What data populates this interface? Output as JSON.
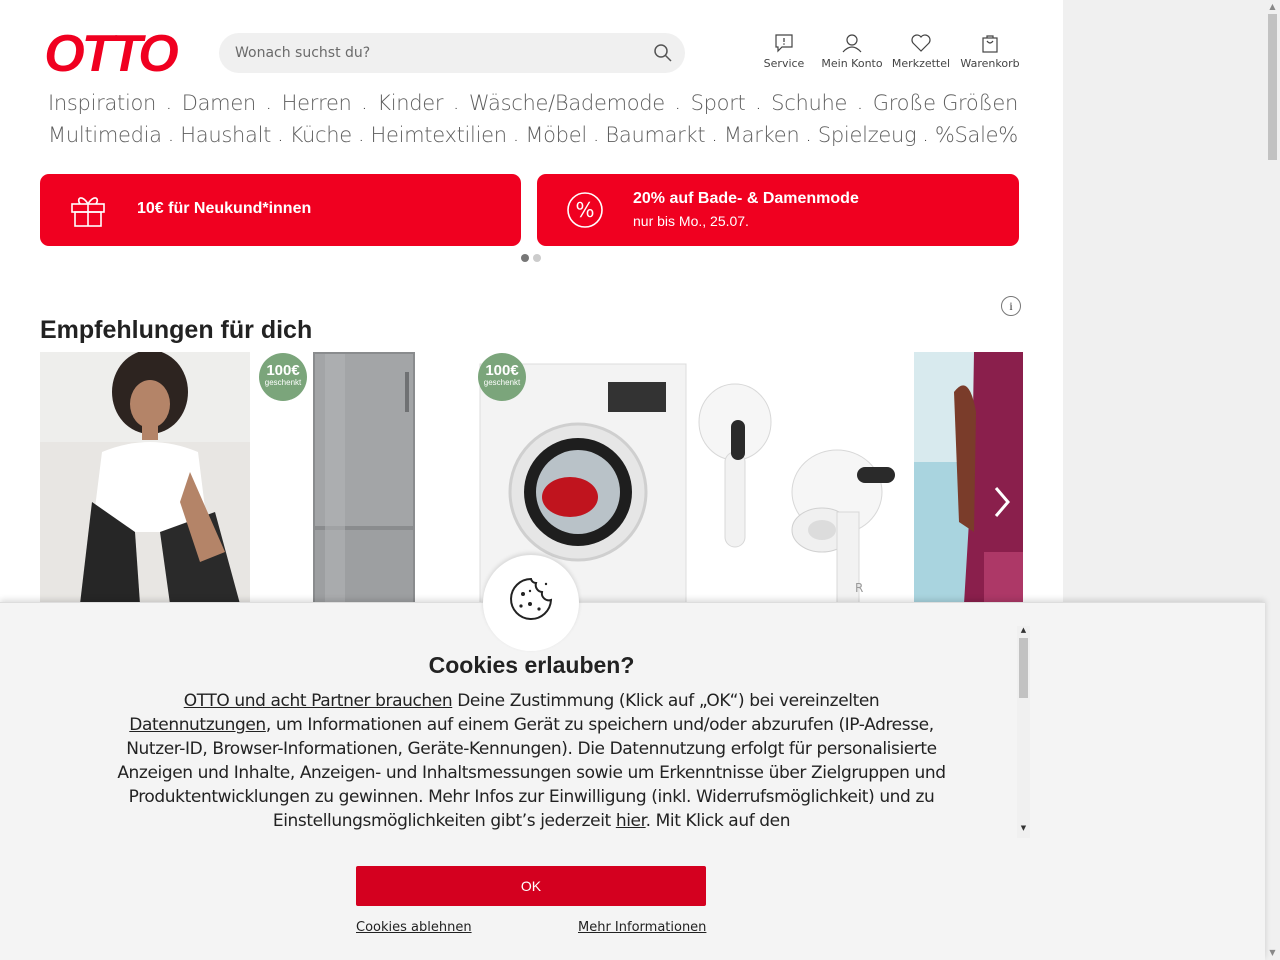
{
  "brand": {
    "logo_text": "OTTO",
    "color": "#f00020"
  },
  "search": {
    "placeholder": "Wonach suchst du?",
    "icon": "search-icon"
  },
  "header_actions": [
    {
      "label": "Service",
      "icon": "chat-icon"
    },
    {
      "label": "Mein Konto",
      "icon": "user-icon"
    },
    {
      "label": "Merkzettel",
      "icon": "heart-icon"
    },
    {
      "label": "Warenkorb",
      "icon": "bag-icon"
    }
  ],
  "nav": {
    "row1": [
      "Inspiration",
      "Damen",
      "Herren",
      "Kinder",
      "Wäsche/Bademode",
      "Sport",
      "Schuhe",
      "Große Größen"
    ],
    "row2": [
      "Multimedia",
      "Haushalt",
      "Küche",
      "Heimtextilien",
      "Möbel",
      "Baumarkt",
      "Marken",
      "Spielzeug",
      "%Sale%"
    ]
  },
  "promos": [
    {
      "title": "10€ für Neukund*innen",
      "subtitle": "",
      "icon": "gift-icon"
    },
    {
      "title": "20% auf Bade- & Damenmode",
      "subtitle": "nur bis Mo., 25.07.",
      "icon": "percent-icon"
    }
  ],
  "carousel": {
    "dots": 2,
    "active": 0
  },
  "recommendations": {
    "title": "Empfehlungen für dich",
    "info_label": "i",
    "badge": {
      "amount": "100€",
      "text": "geschenkt"
    },
    "products": [
      {
        "name": "woman-white-tshirt-image"
      },
      {
        "name": "fridge-image"
      },
      {
        "name": "washing-machine-image"
      },
      {
        "name": "earbuds-image"
      },
      {
        "name": "beach-dress-image"
      }
    ]
  },
  "cookie": {
    "title": "Cookies erlauben?",
    "link_partners": "OTTO und acht Partner brauchen",
    "text1": " Deine Zustimmung (Klick auf „OK“) bei vereinzelten ",
    "link_data": "Datennutzungen",
    "text2": ", um Informationen auf einem Gerät zu speichern und/oder abzurufen (IP-Adresse, Nutzer-ID, Browser-Informationen, Geräte-Kennungen). Die Datennutzung erfolgt für personalisierte Anzeigen und Inhalte, Anzeigen- und Inhaltsmessungen sowie um Erkenntnisse über Zielgruppen und Produktentwicklungen zu gewinnen. Mehr Infos zur Einwilligung (inkl. Widerrufsmöglichkeit) und zu Einstellungsmöglichkeiten gibt’s jederzeit ",
    "link_here": "hier",
    "text3": ". Mit Klick auf den",
    "ok_label": "OK",
    "deny_label": "Cookies ablehnen",
    "more_label": "Mehr Informationen"
  }
}
